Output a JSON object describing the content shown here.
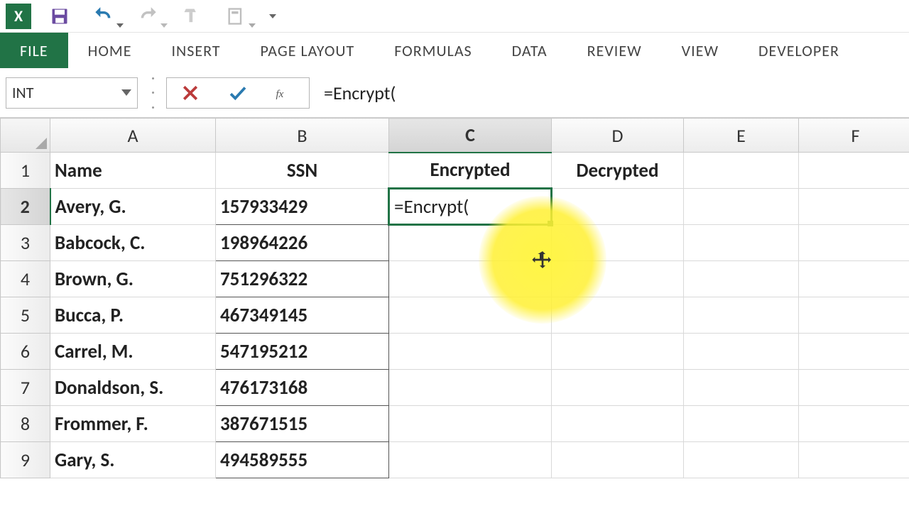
{
  "qat": {
    "save": "save-icon",
    "undo": "undo-icon",
    "redo": "redo-icon",
    "touch": "touch-mode-icon",
    "paste": "paste-options-icon",
    "custom": "customize-qat-icon"
  },
  "ribbon": {
    "file": "FILE",
    "home": "HOME",
    "insert": "INSERT",
    "page": "PAGE LAYOUT",
    "formulas": "FORMULAS",
    "data": "DATA",
    "review": "REVIEW",
    "view": "VIEW",
    "developer": "DEVELOPER"
  },
  "namebox": {
    "value": "INT"
  },
  "formula_bar": {
    "value": "=Encrypt("
  },
  "columns": [
    "A",
    "B",
    "C",
    "D",
    "E",
    "F"
  ],
  "active": {
    "col": "C",
    "row": 2
  },
  "headers": {
    "A": "Name",
    "B": "SSN",
    "C": "Encrypted",
    "D": "Decrypted"
  },
  "rows": [
    {
      "n": 1
    },
    {
      "n": 2,
      "A": "Avery, G.",
      "B": "157933429",
      "C": "=Encrypt("
    },
    {
      "n": 3,
      "A": "Babcock, C.",
      "B": "198964226"
    },
    {
      "n": 4,
      "A": "Brown, G.",
      "B": "751296322"
    },
    {
      "n": 5,
      "A": "Bucca, P.",
      "B": "467349145"
    },
    {
      "n": 6,
      "A": "Carrel, M.",
      "B": "547195212"
    },
    {
      "n": 7,
      "A": "Donaldson, S.",
      "B": "476173168"
    },
    {
      "n": 8,
      "A": "Frommer, F.",
      "B": "387671515"
    },
    {
      "n": 9,
      "A": "Gary, S.",
      "B": "494589555"
    }
  ]
}
